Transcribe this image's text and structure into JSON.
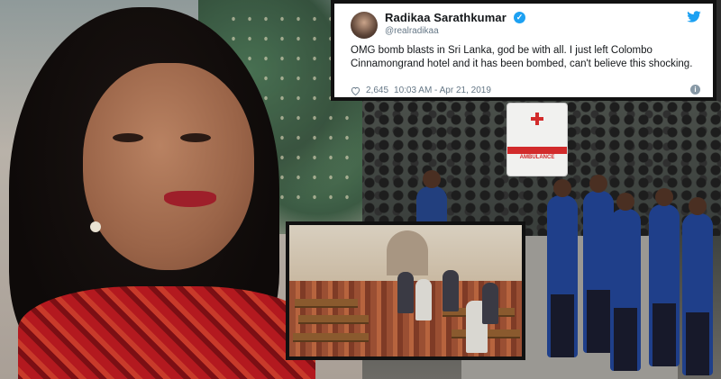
{
  "tweet": {
    "name": "Radikaa Sarathkumar",
    "handle": "@realradikaa",
    "text": "OMG bomb blasts in Sri Lanka, god be with all. I just left Colombo Cinnamongrand hotel and it has been bombed, can't believe this shocking.",
    "likes": "2,645",
    "timestamp": "10:03 AM - Apr 21, 2019",
    "colors": {
      "verified": "#1da1f2",
      "twitter_bird": "#1da1f2",
      "border": "#111111"
    },
    "icons": [
      "verified-badge-icon",
      "twitter-bird-icon",
      "heart-icon",
      "info-icon"
    ]
  },
  "photo_scene": {
    "ambulance_label": "AMBULANCE"
  }
}
